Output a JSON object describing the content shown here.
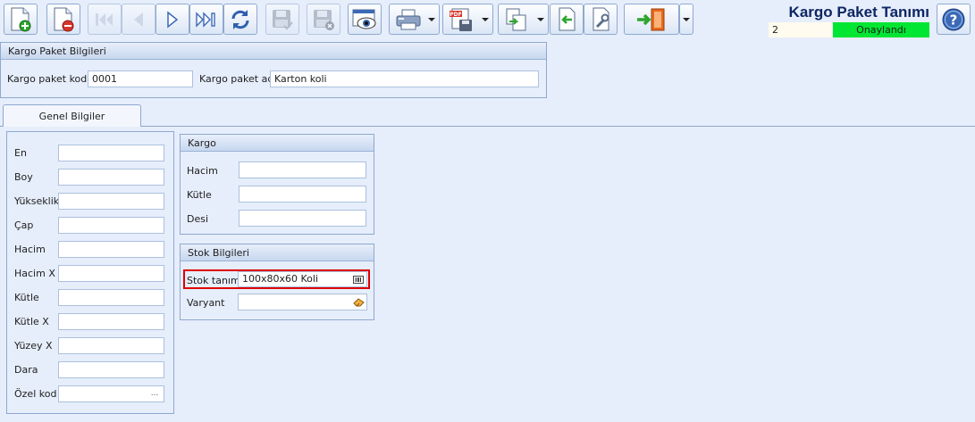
{
  "toolbar": {
    "buttons": [
      {
        "name": "new-record-button",
        "icon": "new-document-plus-icon",
        "enabled": true
      },
      {
        "name": "delete-record-button",
        "icon": "document-minus-icon",
        "enabled": true
      },
      {
        "name": "first-record-button",
        "icon": "first-record-icon",
        "enabled": false
      },
      {
        "name": "previous-record-button",
        "icon": "previous-record-icon",
        "enabled": false
      },
      {
        "name": "next-record-button",
        "icon": "next-record-icon",
        "enabled": true
      },
      {
        "name": "last-record-button",
        "icon": "last-record-icon",
        "enabled": true
      },
      {
        "name": "refresh-button",
        "icon": "refresh-icon",
        "enabled": true
      },
      {
        "name": "save-button",
        "icon": "floppy-check-icon",
        "enabled": false
      },
      {
        "name": "save-delete-button",
        "icon": "floppy-cancel-icon",
        "enabled": false
      },
      {
        "name": "preview-button",
        "icon": "eye-window-icon",
        "enabled": true
      },
      {
        "name": "print-button",
        "icon": "printer-icon",
        "enabled": true
      },
      {
        "name": "pdf-export-button",
        "icon": "pdf-save-icon",
        "enabled": true
      },
      {
        "name": "copy-button",
        "icon": "copy-documents-icon",
        "enabled": true
      },
      {
        "name": "back-document-button",
        "icon": "document-back-icon",
        "enabled": true
      },
      {
        "name": "tools-button",
        "icon": "document-wrench-icon",
        "enabled": true
      },
      {
        "name": "exit-button",
        "icon": "exit-door-icon",
        "enabled": true
      }
    ],
    "pdf_text": "PDF"
  },
  "header": {
    "title": "Kargo Paket Tanımı",
    "record_no": "2",
    "status": "Onaylandı",
    "status_color": "#00e632",
    "help_icon": "help-question-icon"
  },
  "package_info": {
    "header": "Kargo Paket Bilgileri",
    "code_label": "Kargo paket kodu",
    "code_value": "0001",
    "name_label": "Kargo paket adı",
    "name_value": "Karton koli"
  },
  "tabs": {
    "general_label": "Genel Bilgiler"
  },
  "dimensions": {
    "fields": [
      {
        "label": "En",
        "value": ""
      },
      {
        "label": "Boy",
        "value": ""
      },
      {
        "label": "Yükseklik",
        "value": ""
      },
      {
        "label": "Çap",
        "value": ""
      },
      {
        "label": "Hacim",
        "value": ""
      },
      {
        "label": "Hacim X",
        "value": ""
      },
      {
        "label": "Kütle",
        "value": ""
      },
      {
        "label": "Kütle X",
        "value": ""
      },
      {
        "label": "Yüzey X",
        "value": ""
      },
      {
        "label": "Dara",
        "value": ""
      },
      {
        "label": "Özel kod",
        "value": ""
      }
    ],
    "ellipsis": "..."
  },
  "cargo": {
    "header": "Kargo",
    "fields": [
      {
        "label": "Hacim",
        "value": ""
      },
      {
        "label": "Kütle",
        "value": ""
      },
      {
        "label": "Desi",
        "value": ""
      }
    ]
  },
  "stock": {
    "header": "Stok Bilgileri",
    "stock_label": "Stok tanımı",
    "stock_value": "100x80x60 Koli",
    "stock_icon": "barcode-icon",
    "variant_label": "Varyant",
    "variant_value": "",
    "variant_icon": "eraser-icon",
    "highlight_color": "#e00000"
  }
}
